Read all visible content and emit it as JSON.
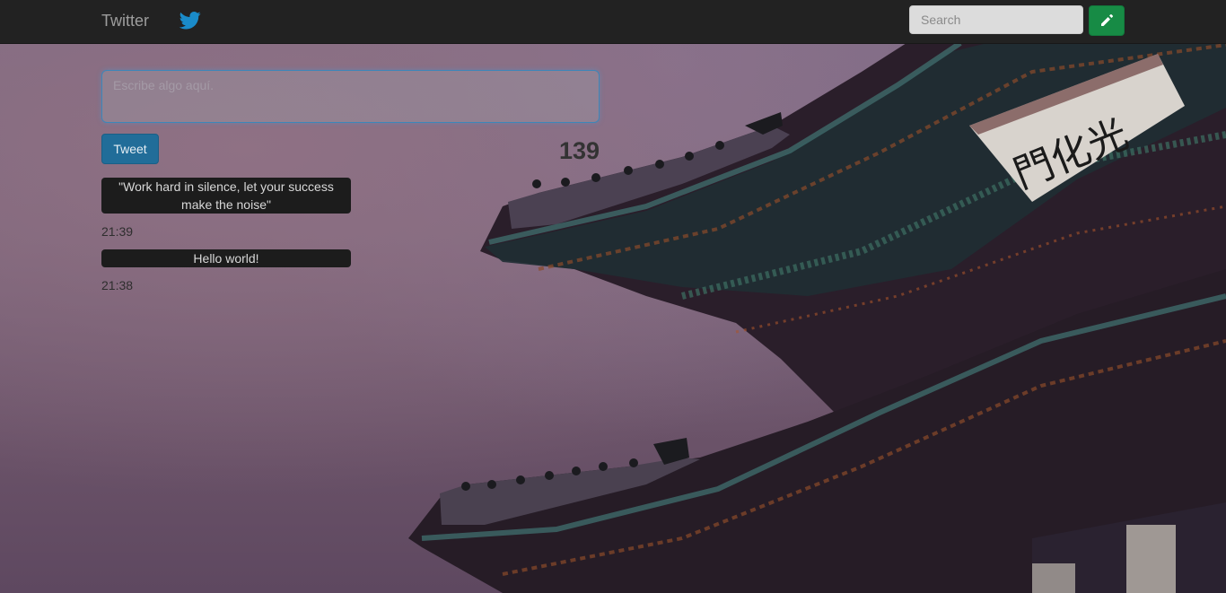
{
  "navbar": {
    "brand": "Twitter",
    "bird_icon": "twitter-bird-icon",
    "search_placeholder": "Search",
    "edit_icon": "pencil-icon"
  },
  "compose": {
    "placeholder": "Escribe algo aquí.",
    "tweet_button": "Tweet",
    "char_counter": "139"
  },
  "tweets": [
    {
      "text": "\"Work hard in silence, let your success make the noise\"",
      "time": "21:39"
    },
    {
      "text": "Hello world!",
      "time": "21:38"
    }
  ],
  "colors": {
    "navbar": "#222222",
    "accent_green": "#178b45",
    "accent_blue": "#216d99",
    "twitter_blue": "#1a8bc9"
  }
}
